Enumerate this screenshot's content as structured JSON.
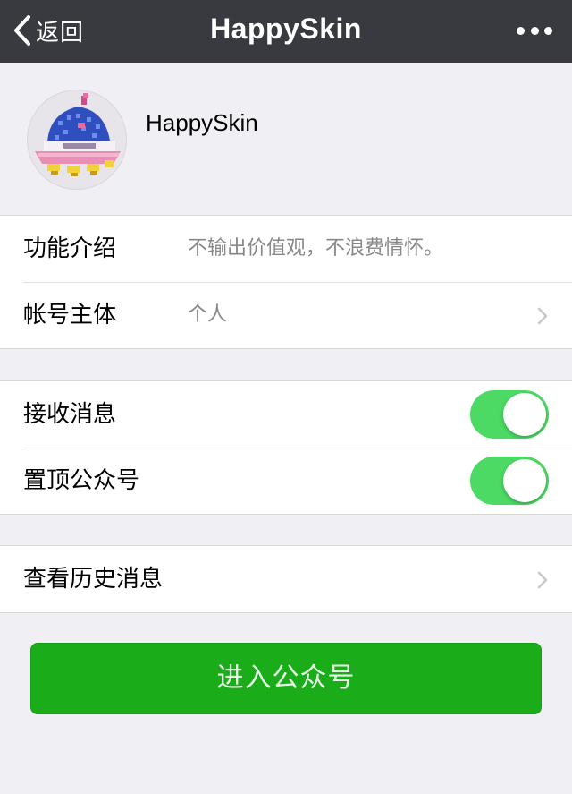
{
  "navbar": {
    "back_label": "返回",
    "title": "HappySkin",
    "more_icon": "more-dots-icon",
    "back_icon": "chevron-left-icon"
  },
  "profile": {
    "name": "HappySkin",
    "avatar_icon": "pixel-ufo-avatar"
  },
  "info": {
    "rows": [
      {
        "label": "功能介绍",
        "value": "不输出价值观，不浪费情怀。"
      },
      {
        "label": "帐号主体",
        "value": "个人"
      }
    ]
  },
  "settings": {
    "rows": [
      {
        "label": "接收消息",
        "enabled": true
      },
      {
        "label": "置顶公众号",
        "enabled": true
      }
    ]
  },
  "history": {
    "label": "查看历史消息"
  },
  "enter_button": {
    "label": "进入公众号"
  },
  "colors": {
    "navbar_bg": "#393a3f",
    "page_bg": "#efeff4",
    "toggle_on": "#4cd964",
    "primary_button": "#1aad19"
  }
}
